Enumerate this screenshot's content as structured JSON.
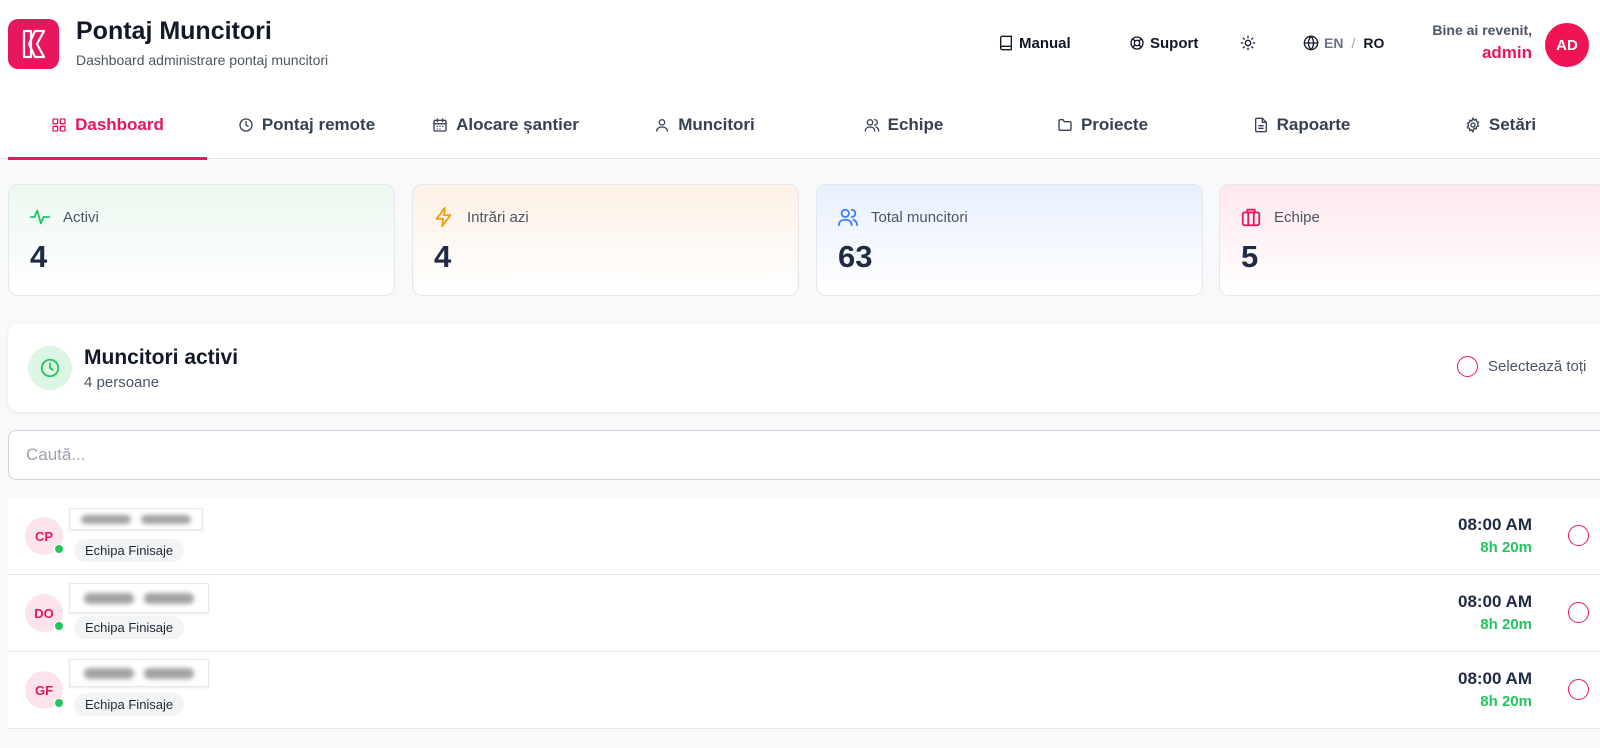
{
  "header": {
    "title": "Pontaj Muncitori",
    "subtitle": "Dashboard administrare pontaj muncitori",
    "manual_label": "Manual",
    "support_label": "Suport",
    "lang_en": "EN",
    "lang_sep": "/",
    "lang_ro": "RO",
    "welcome_text": "Bine ai revenit,",
    "username": "admin",
    "avatar_initials": "AD"
  },
  "tabs": [
    {
      "label": "Dashboard",
      "icon": "grid-icon",
      "active": true
    },
    {
      "label": "Pontaj remote",
      "icon": "clock-icon"
    },
    {
      "label": "Alocare șantier",
      "icon": "calendar-icon"
    },
    {
      "label": "Muncitori",
      "icon": "user-icon"
    },
    {
      "label": "Echipe",
      "icon": "users-icon"
    },
    {
      "label": "Proiecte",
      "icon": "folder-icon"
    },
    {
      "label": "Rapoarte",
      "icon": "file-icon"
    },
    {
      "label": "Setări",
      "icon": "gear-icon"
    }
  ],
  "stats": [
    {
      "label": "Activi",
      "value": "4",
      "icon": "activity-icon",
      "color": "#22c55e"
    },
    {
      "label": "Intrări azi",
      "value": "4",
      "icon": "lightning-icon",
      "color": "#f59e0b"
    },
    {
      "label": "Total muncitori",
      "value": "63",
      "icon": "users-icon",
      "color": "#3b82f6"
    },
    {
      "label": "Echipe",
      "value": "5",
      "icon": "briefcase-icon",
      "color": "#e8175d"
    }
  ],
  "active_panel": {
    "title": "Muncitori activi",
    "subtitle": "4 persoane",
    "select_all_label": "Selectează toți"
  },
  "search": {
    "placeholder": "Caută..."
  },
  "workers": [
    {
      "initials": "CP",
      "team": "Echipa Finisaje",
      "time": "08:00 AM",
      "duration": "8h 20m",
      "online": true
    },
    {
      "initials": "DO",
      "team": "Echipa Finisaje",
      "time": "08:00 AM",
      "duration": "8h 20m",
      "online": true
    },
    {
      "initials": "GF",
      "team": "Echipa Finisaje",
      "time": "08:00 AM",
      "duration": "8h 20m",
      "online": true
    }
  ],
  "colors": {
    "accent": "#e8175d",
    "online": "#22c55e"
  }
}
